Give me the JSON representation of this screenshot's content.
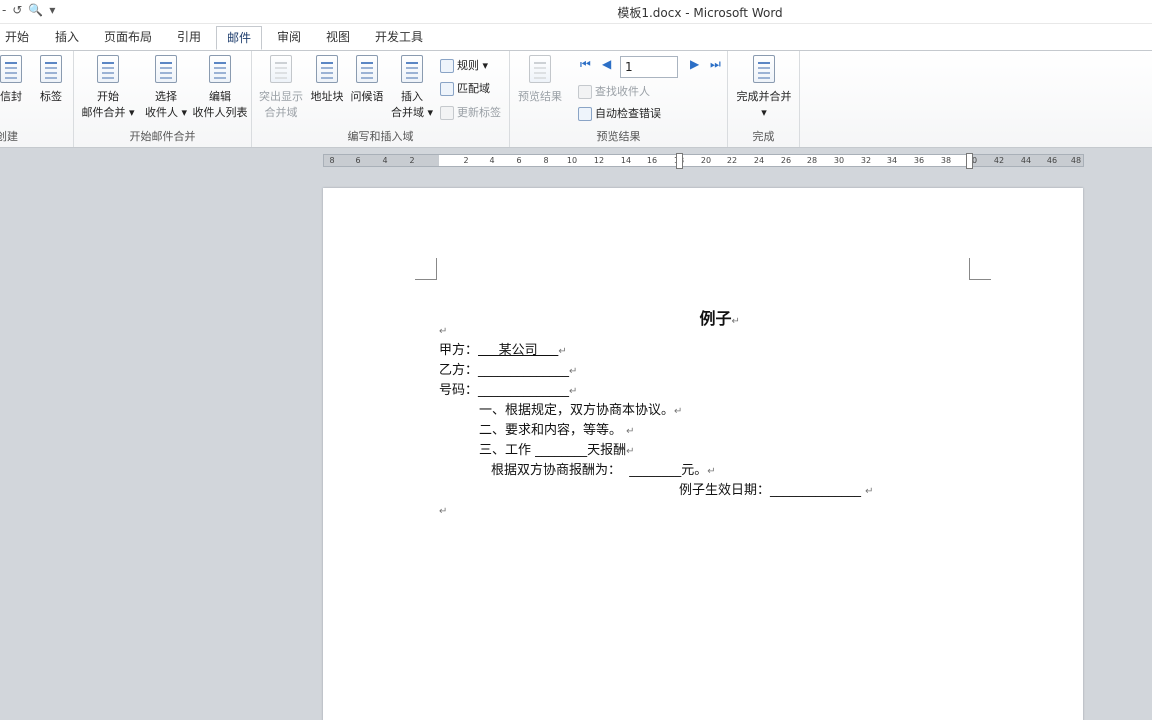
{
  "window": {
    "title": "模板1.docx - Microsoft Word"
  },
  "qat": {
    "undo": "↺",
    "preview": "🔍",
    "more": "▾"
  },
  "tabs": [
    "开始",
    "插入",
    "页面布局",
    "引用",
    "邮件",
    "审阅",
    "视图",
    "开发工具"
  ],
  "active_tab": "邮件",
  "ribbon": {
    "create": {
      "label": "创建",
      "envelope": "信封",
      "labels": "标签"
    },
    "start_merge": {
      "label": "开始邮件合并",
      "start_l1": "开始",
      "start_l2": "邮件合并 ▾",
      "select_l1": "选择",
      "select_l2": "收件人 ▾",
      "edit_l1": "编辑",
      "edit_l2": "收件人列表"
    },
    "write_insert": {
      "label": "编写和插入域",
      "highlight_l1": "突出显示",
      "highlight_l2": "合并域",
      "address": "地址块",
      "greeting": "问候语",
      "insert_l1": "插入",
      "insert_l2": "合并域 ▾",
      "rules": "规则 ▾",
      "match": "匹配域",
      "update": "更新标签"
    },
    "preview": {
      "label": "预览结果",
      "preview_btn": "预览结果",
      "record_value": "1",
      "find": "查找收件人",
      "auto_check": "自动检查错误"
    },
    "finish": {
      "label": "完成",
      "finish_l1": "完成并合并",
      "finish_l2": "▾"
    }
  },
  "ruler": {
    "left_ticks": [
      "8",
      "6",
      "4",
      "2"
    ],
    "right_ticks": [
      "2",
      "4",
      "6",
      "8",
      "10",
      "12",
      "14",
      "16",
      "18",
      "20",
      "22",
      "24",
      "26",
      "28",
      "30",
      "32",
      "34",
      "36",
      "38",
      "40",
      "42",
      "44",
      "46",
      "48"
    ]
  },
  "document": {
    "title": "例子",
    "party_a_label": "甲方：",
    "party_a_value": "     某公司     ",
    "party_b": "乙方：______________",
    "number": "号码：______________",
    "item1": "一、根据规定，双方协商本协议。",
    "item2": "二、要求和内容，等等。",
    "item3": "三、工作 ________天报酬",
    "pay": "根据双方协商报酬为：  ________元。",
    "effective": "例子生效日期：______________ ",
    "para_mark": "↵"
  }
}
